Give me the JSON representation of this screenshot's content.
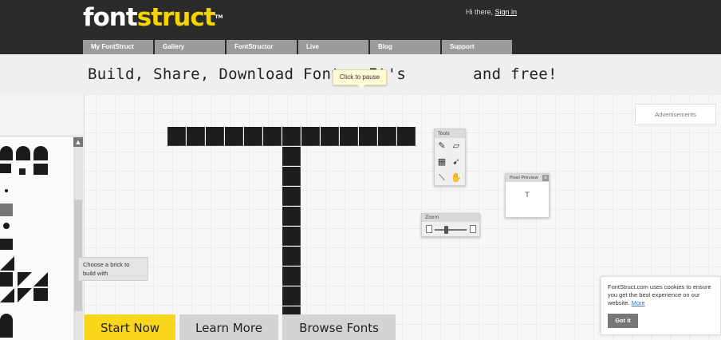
{
  "header": {
    "logo_part1": "font",
    "logo_part2": "struct",
    "logo_tm": "TM",
    "greeting": "Hi there,",
    "sign_in": "Sign in",
    "nav": [
      "My FontStruct",
      "Gallery",
      "FontStructor",
      "Live",
      "Blog",
      "Support"
    ]
  },
  "hero": {
    "tagline_start": "Build, Share, Download Fonts. It's",
    "tagline_end": "and free!",
    "pause_tooltip": "Click to pause"
  },
  "editor": {
    "brick_hint": "Choose a brick to build with",
    "tools_title": "Tools",
    "tools": [
      {
        "icon": "pencil-icon",
        "glyph": "✎"
      },
      {
        "icon": "eraser-icon",
        "glyph": "▱"
      },
      {
        "icon": "grid-icon",
        "glyph": "▦"
      },
      {
        "icon": "select-arrow-icon",
        "glyph": "➹"
      },
      {
        "icon": "line-tool-icon",
        "glyph": "⟍"
      },
      {
        "icon": "hand-icon",
        "glyph": "✋"
      }
    ],
    "zoom_title": "Zoom",
    "zoom_level": 0.35,
    "pixel_preview_title": "Pixel Preview",
    "pixel_preview_close": "x",
    "pixel_preview_char": "T",
    "palette_scroll_up": "▲"
  },
  "ads_label": "Advertisements",
  "cta": {
    "start": "Start Now",
    "learn": "Learn More",
    "browse": "Browse Fonts"
  },
  "cookie": {
    "text": "FontStruct.com uses cookies to ensure you get the best experience on our website.",
    "more": "More",
    "button": "Got it"
  },
  "colors": {
    "header_bg": "#2b2b2b",
    "brand_yellow": "#f5d400",
    "cta_yellow": "#f9d51b",
    "nav_tab": "#9b9b9b"
  }
}
